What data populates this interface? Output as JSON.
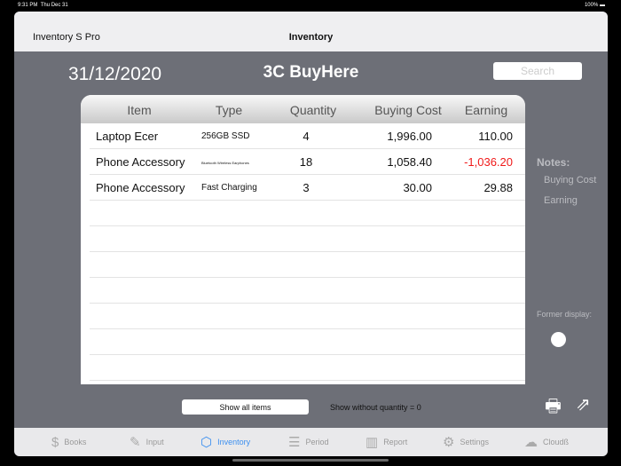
{
  "status": {
    "time": "9:31 PM",
    "date": "Thu Dec 31",
    "battery": "100%"
  },
  "header": {
    "app_name": "Inventory S Pro",
    "title": "Inventory"
  },
  "date": "31/12/2020",
  "shop_name": "3C BuyHere",
  "search": {
    "placeholder": "Search"
  },
  "table": {
    "columns": [
      "Item",
      "Type",
      "Quantity",
      "Buying Cost",
      "Earning"
    ],
    "rows": [
      {
        "item": "Laptop Ecer",
        "type": "256GB SSD",
        "quantity": "4",
        "cost": "1,996.00",
        "earning": "110.00"
      },
      {
        "item": "Phone Accessory",
        "type": "Bluetooth Wireless Earphones",
        "quantity": "18",
        "cost": "1,058.40",
        "earning": "-1,036.20"
      },
      {
        "item": "Phone Accessory",
        "type": "Fast Charging",
        "quantity": "3",
        "cost": "30.00",
        "earning": "29.88"
      }
    ]
  },
  "notes": {
    "title": "Notes:",
    "items": [
      "Buying Cost",
      "Earning"
    ]
  },
  "former_display": "Former display:",
  "show_all_label": "Show all items",
  "show_without_qty": "Show without quantity = 0",
  "tabs": [
    {
      "label": "Books",
      "icon": "dollar-doc-icon"
    },
    {
      "label": "Input",
      "icon": "edit-icon"
    },
    {
      "label": "Inventory",
      "icon": "box-icon"
    },
    {
      "label": "Period",
      "icon": "clipboard-icon"
    },
    {
      "label": "Report",
      "icon": "bar-chart-icon"
    },
    {
      "label": "Settings",
      "icon": "gear-icon"
    },
    {
      "label": "Cloudß",
      "icon": "cloud-icon"
    }
  ],
  "colors": {
    "accent": "#3b8ff0",
    "negative": "#f01a1a",
    "panel": "#6d6f77"
  }
}
